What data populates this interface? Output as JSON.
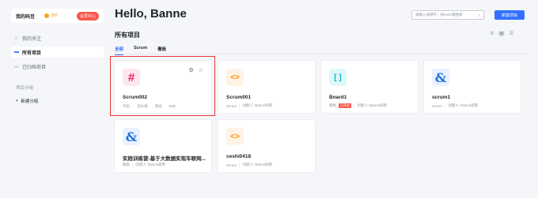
{
  "sidebar": {
    "user_name": "我的码豆",
    "coins": "390",
    "member_label": "会员中心",
    "nav": [
      {
        "label": "我的关注",
        "icon": "star-icon"
      },
      {
        "label": "所有项目",
        "icon": "folder-icon"
      },
      {
        "label": "已归档项目",
        "icon": "archive-icon"
      }
    ],
    "group_title": "项目分组",
    "add_group": "新建分组"
  },
  "header": {
    "greeting": "Hello, Banne",
    "search_placeholder": "请输入关键字，按enter键搜索",
    "new_project": "新建项目"
  },
  "section_title": "所有项目",
  "tabs": [
    "全部",
    "Scrum",
    "看板"
  ],
  "projects": [
    {
      "title": "Scrum002",
      "links": [
        "代码",
        "流水线",
        "测试",
        "Wiki"
      ]
    },
    {
      "title": "Scrum001",
      "type": "Scrum",
      "creator": "创建人: Banne昵称"
    },
    {
      "title": "Board1",
      "type": "看板",
      "tag": "已开启",
      "creator": "创建人: Banne昵称"
    },
    {
      "title": "scrum1",
      "type": "Scrum",
      "creator": "创建人: Banne昵称"
    },
    {
      "title": "实践训练营-基于大数据实现车联网...",
      "type": "看板",
      "creator": "创建人: Banne昵称"
    },
    {
      "title": "ceshi0418",
      "type": "Scrum",
      "creator": "创建人: Banne昵称"
    }
  ],
  "colors": {
    "accent": "#3370ff",
    "badge": "#f5584a",
    "highlight": "#e53935"
  }
}
